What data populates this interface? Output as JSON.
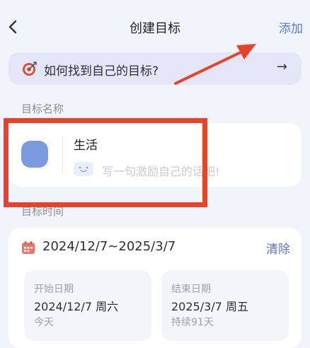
{
  "header": {
    "title": "创建目标",
    "action_label": "添加"
  },
  "banner": {
    "text": "如何找到自己的目标?",
    "arrow": "→"
  },
  "name_section": {
    "label": "目标名称",
    "name_value": "生活",
    "slogan_placeholder": "写一句激励自己的话吧!"
  },
  "time_section": {
    "label": "目标时间",
    "range_text": "2024/12/7~2025/3/7",
    "clear_label": "清除",
    "start": {
      "label": "开始日期",
      "date": "2024/12/7 周六",
      "sub": "今天"
    },
    "end": {
      "label": "结束日期",
      "date": "2025/3/7 周五",
      "sub": "持续91天"
    }
  },
  "colors": {
    "accent": "#5b79c7",
    "avatar": "#7b9ae0",
    "annotation": "#e5432c",
    "background": "#f1f4fb"
  },
  "icons": [
    "back-chevron-icon",
    "target-icon",
    "arrow-right-icon",
    "smile-icon",
    "calendar-icon"
  ]
}
